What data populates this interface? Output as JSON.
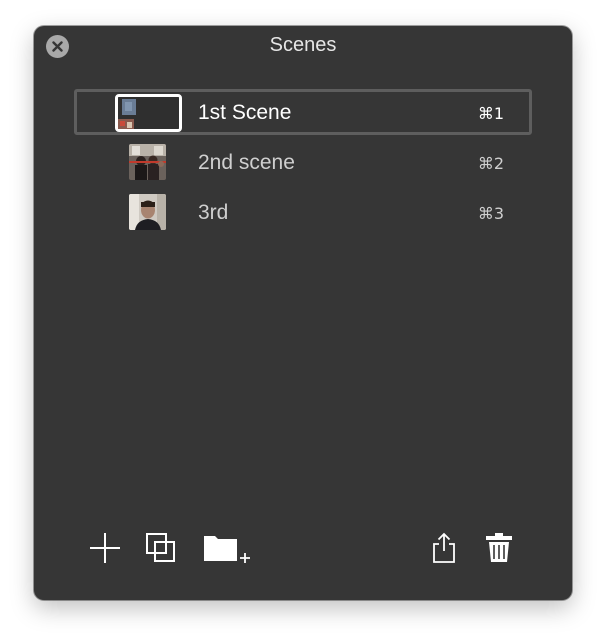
{
  "window": {
    "title": "Scenes"
  },
  "scenes": [
    {
      "name": "1st Scene",
      "shortcut": "⌘1",
      "selected": true
    },
    {
      "name": "2nd scene",
      "shortcut": "⌘2",
      "selected": false
    },
    {
      "name": "3rd",
      "shortcut": "⌘3",
      "selected": false
    }
  ],
  "toolbar": {
    "left": [
      "plus-icon",
      "duplicate-icon",
      "new-folder-icon"
    ],
    "right": [
      "share-icon",
      "trash-icon"
    ]
  },
  "colors": {
    "panel_bg": "#363636",
    "selection_border": "#5e5e5e",
    "text": "#cfcfcf",
    "selected_text": "#ffffff"
  }
}
